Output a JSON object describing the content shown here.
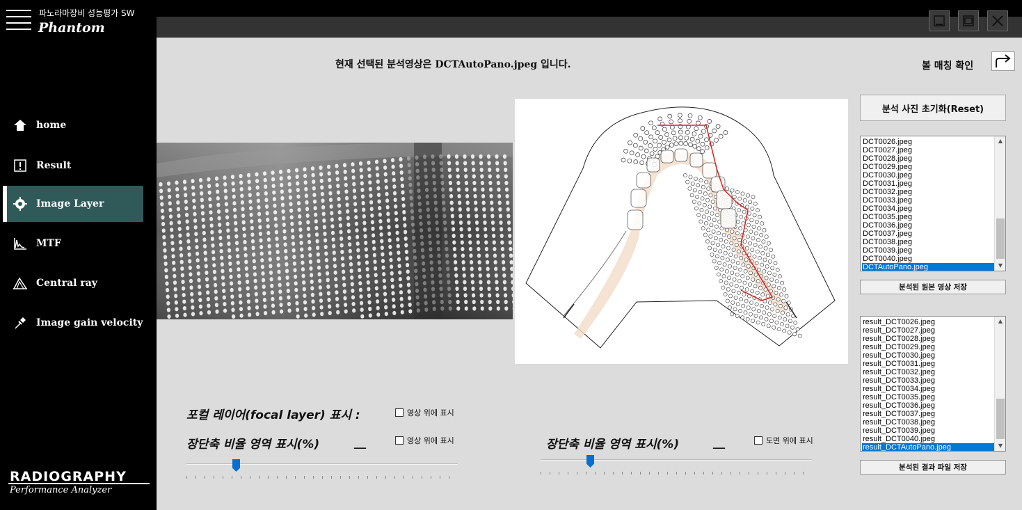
{
  "app": {
    "title_ko": "파노라마장비 성능평가 SW",
    "title_en": "Phantom",
    "logo_main": "RADIOGRAPHY",
    "logo_sub": "Performance Analyzer"
  },
  "sidebar": {
    "items": [
      {
        "label": "home",
        "icon": "home-icon"
      },
      {
        "label": "Result",
        "icon": "info-icon"
      },
      {
        "label": "Image Layer",
        "icon": "target-icon",
        "active": true
      },
      {
        "label": "MTF",
        "icon": "mtf-graph-icon"
      },
      {
        "label": "Central ray",
        "icon": "central-ray-icon"
      },
      {
        "label": "Image gain velocity",
        "icon": "pin-icon"
      }
    ]
  },
  "main": {
    "headline": "현재 선택된 분석영상은 DCTAutoPano.jpeg 입니다.",
    "ball_matching_label": "볼 매칭 확인",
    "reset_button": "분석 사진 초기화(Reset)",
    "save_original_button": "분석된 원본 영상 저장",
    "save_result_button": "분석된 결과 파일 저장",
    "source_files": [
      "DCT0026.jpeg",
      "DCT0027.jpeg",
      "DCT0028.jpeg",
      "DCT0029.jpeg",
      "DCT0030.jpeg",
      "DCT0031.jpeg",
      "DCT0032.jpeg",
      "DCT0033.jpeg",
      "DCT0034.jpeg",
      "DCT0035.jpeg",
      "DCT0036.jpeg",
      "DCT0037.jpeg",
      "DCT0038.jpeg",
      "DCT0039.jpeg",
      "DCT0040.jpeg",
      "DCTAutoPano.jpeg"
    ],
    "source_selected": "DCTAutoPano.jpeg",
    "result_files": [
      "result_DCT0026.jpeg",
      "result_DCT0027.jpeg",
      "result_DCT0028.jpeg",
      "result_DCT0029.jpeg",
      "result_DCT0030.jpeg",
      "result_DCT0031.jpeg",
      "result_DCT0032.jpeg",
      "result_DCT0033.jpeg",
      "result_DCT0034.jpeg",
      "result_DCT0035.jpeg",
      "result_DCT0036.jpeg",
      "result_DCT0037.jpeg",
      "result_DCT0038.jpeg",
      "result_DCT0039.jpeg",
      "result_DCT0040.jpeg",
      "result_DCTAutoPano.jpeg"
    ],
    "result_selected": "result_DCTAutoPano.jpeg",
    "focal_layer_label": "포컬 레이어(focal layer) 표시 :",
    "focal_layer_checkbox": "영상 위에 표시",
    "axis_ratio_label_left": "장단축 비율 영역 표시(%)",
    "axis_ratio_value_left": "__",
    "axis_ratio_checkbox_left": "영상 위에 표시",
    "slider_left_fraction": 0.17,
    "axis_ratio_label_right": "장단축 비율 영역 표시(%)",
    "axis_ratio_value_right": "__",
    "axis_ratio_checkbox_right": "도면 위에 표시",
    "slider_right_fraction": 0.17
  },
  "colors": {
    "active_nav": "#2f5a59",
    "selection": "#0078d7",
    "slider_thumb": "#0a6dd1",
    "path_line": "#e02020",
    "tooth_tint": "#f3dcc8"
  }
}
